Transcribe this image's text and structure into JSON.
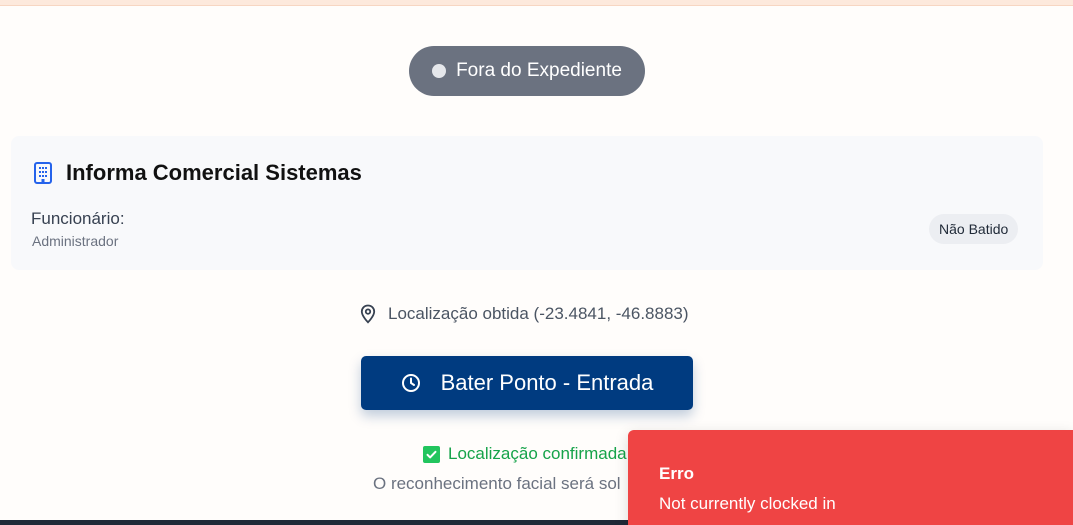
{
  "status": {
    "label": "Fora do Expediente",
    "color": "#6b7280"
  },
  "company": {
    "icon": "building-icon",
    "name": "Informa Comercial Sistemas"
  },
  "employee": {
    "label": "Funcionário:",
    "name": "Administrador"
  },
  "punch_status": "Não Batido",
  "location": {
    "icon": "map-pin-icon",
    "text": "Localização obtida (-23.4841, -46.8883)"
  },
  "punch_button": {
    "icon": "clock-icon",
    "label": "Bater Ponto - Entrada",
    "color": "#003b80"
  },
  "confirmation": {
    "icon": "check-box-icon",
    "text": "Localização confirmada",
    "color": "#16a34a"
  },
  "facial_note": "O reconhecimento facial será sol",
  "toast": {
    "title": "Erro",
    "message": "Not currently clocked in",
    "color": "#ef4444"
  }
}
